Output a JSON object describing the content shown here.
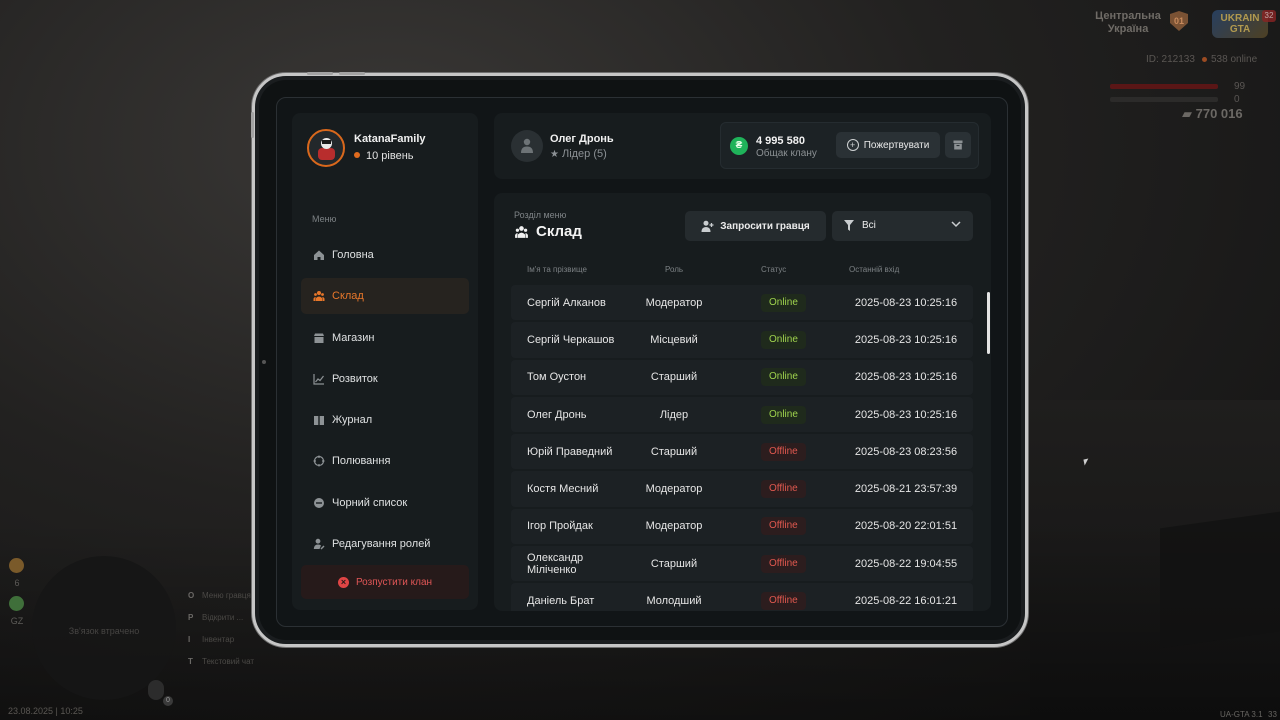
{
  "hud": {
    "region_line1": "Центральна",
    "region_line2": "Україна",
    "region_badge": "01",
    "logo_line1": "UKRAIN",
    "logo_line2": "GTA",
    "notification_count": "32",
    "player_id": "ID: 212133",
    "online": "538 online",
    "health": "99",
    "armor": "0",
    "money": "770 016",
    "stat_top": "6",
    "stat_bottom": "GZ",
    "map_caption": "Зв'язок втрачено",
    "mic_count": "0",
    "hints": [
      {
        "key": "O",
        "label": "Меню гравця"
      },
      {
        "key": "P",
        "label": "Відкрити ..."
      },
      {
        "key": "I",
        "label": "Інвентар"
      },
      {
        "key": "T",
        "label": "Текстовий чат"
      }
    ],
    "datetime": "23.08.2025 | 10:25",
    "version": "UA-GTA 3.1",
    "version_num": "33"
  },
  "profile": {
    "clan_name": "KatanaFamily",
    "level": "10 рівень"
  },
  "menu": {
    "title": "Меню",
    "items": [
      {
        "label": "Головна",
        "icon": "home-icon"
      },
      {
        "label": "Склад",
        "icon": "people-icon",
        "active": true
      },
      {
        "label": "Магазин",
        "icon": "shop-icon"
      },
      {
        "label": "Розвиток",
        "icon": "chart-icon"
      },
      {
        "label": "Журнал",
        "icon": "book-icon"
      },
      {
        "label": "Полювання",
        "icon": "target-icon"
      },
      {
        "label": "Чорний список",
        "icon": "minus-circle-icon"
      },
      {
        "label": "Редагування ролей",
        "icon": "user-edit-icon"
      }
    ],
    "disband_label": "Розпустити клан"
  },
  "header": {
    "leader_name": "Олег Дронь",
    "leader_role": "Лідер (5)",
    "balance_value": "4 995 580",
    "balance_label": "Общак клану",
    "donate_label": "Пожертвувати"
  },
  "section": {
    "label": "Розділ меню",
    "title": "Склад",
    "invite_label": "Запросити гравця",
    "filter_value": "Всі"
  },
  "table": {
    "columns": [
      "Ім'я та прізвище",
      "Роль",
      "Статус",
      "Останній вхід"
    ],
    "rows": [
      {
        "name": "Сергій Алканов",
        "role": "Модератор",
        "status": "Online",
        "last": "2025-08-23 10:25:16"
      },
      {
        "name": "Сергій Черкашов",
        "role": "Місцевий",
        "status": "Online",
        "last": "2025-08-23 10:25:16"
      },
      {
        "name": "Том Оустон",
        "role": "Старший",
        "status": "Online",
        "last": "2025-08-23 10:25:16"
      },
      {
        "name": "Олег Дронь",
        "role": "Лідер",
        "status": "Online",
        "last": "2025-08-23 10:25:16"
      },
      {
        "name": "Юрій Праведний",
        "role": "Старший",
        "status": "Offline",
        "last": "2025-08-23 08:23:56"
      },
      {
        "name": "Костя Месний",
        "role": "Модератор",
        "status": "Offline",
        "last": "2025-08-21 23:57:39"
      },
      {
        "name": "Ігор Пройдак",
        "role": "Модератор",
        "status": "Offline",
        "last": "2025-08-20 22:01:51"
      },
      {
        "name": "Олександр Міліченко",
        "role": "Старший",
        "status": "Offline",
        "last": "2025-08-22 19:04:55"
      },
      {
        "name": "Даніель Брат",
        "role": "Молодший",
        "status": "Offline",
        "last": "2025-08-22 16:01:21"
      }
    ]
  },
  "colors": {
    "accent": "#e8772a",
    "online": "#9fd34d",
    "offline": "#e0584f",
    "coin": "#1fb35a"
  }
}
